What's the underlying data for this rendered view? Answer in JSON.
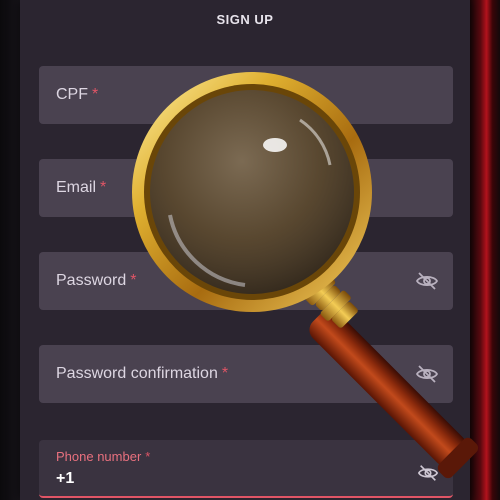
{
  "form": {
    "title": "SIGN UP",
    "required_marker": "*",
    "fields": [
      {
        "label": "CPF",
        "type": "text"
      },
      {
        "label": "Email",
        "type": "email"
      },
      {
        "label": "Password",
        "type": "password",
        "icon": "eye-off-icon"
      },
      {
        "label": "Password confirmation",
        "type": "password",
        "icon": "eye-off-icon"
      }
    ],
    "phone": {
      "label": "Phone number",
      "value": "+1",
      "icon": "eye-off-icon"
    }
  },
  "overlay": {
    "icon": "magnifying-glass-icon"
  },
  "colors": {
    "panel": "#2b2530",
    "field": "#4a4250",
    "required": "#e05566",
    "accent_right": "#b3121c"
  }
}
